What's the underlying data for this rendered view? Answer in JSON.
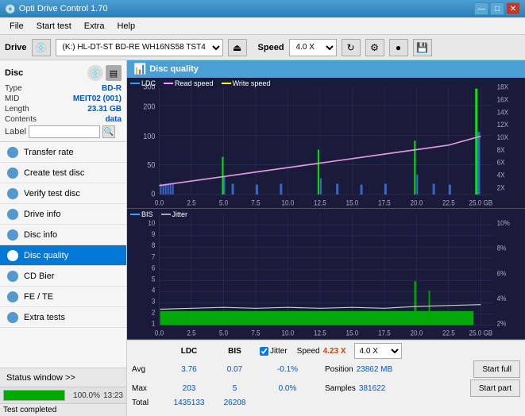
{
  "titlebar": {
    "title": "Opti Drive Control 1.70",
    "minimize": "—",
    "maximize": "□",
    "close": "✕"
  },
  "menubar": {
    "items": [
      "File",
      "Start test",
      "Extra",
      "Help"
    ]
  },
  "drivebar": {
    "label": "Drive",
    "drive_value": "(K:) HL-DT-ST BD-RE  WH16NS58 TST4",
    "speed_label": "Speed",
    "speed_value": "4.0 X"
  },
  "sidebar": {
    "disc_title": "Disc",
    "disc_type_label": "Type",
    "disc_type_val": "BD-R",
    "disc_mid_label": "MID",
    "disc_mid_val": "MEIT02 (001)",
    "disc_length_label": "Length",
    "disc_length_val": "23.31 GB",
    "disc_contents_label": "Contents",
    "disc_contents_val": "data",
    "disc_label_label": "Label",
    "disc_label_val": "",
    "nav_items": [
      {
        "id": "transfer-rate",
        "label": "Transfer rate"
      },
      {
        "id": "create-test-disc",
        "label": "Create test disc"
      },
      {
        "id": "verify-test-disc",
        "label": "Verify test disc"
      },
      {
        "id": "drive-info",
        "label": "Drive info"
      },
      {
        "id": "disc-info",
        "label": "Disc info"
      },
      {
        "id": "disc-quality",
        "label": "Disc quality",
        "active": true
      },
      {
        "id": "cd-bier",
        "label": "CD Bier"
      },
      {
        "id": "fe-te",
        "label": "FE / TE"
      },
      {
        "id": "extra-tests",
        "label": "Extra tests"
      }
    ],
    "status_window_label": "Status window >>",
    "progress_pct": "100.0%",
    "progress_time": "13:23"
  },
  "content": {
    "dq_title": "Disc quality",
    "chart1": {
      "legend_ldc": "LDC",
      "legend_read": "Read speed",
      "legend_write": "Write speed",
      "y_left_max": 300,
      "y_right_labels": [
        "18X",
        "16X",
        "14X",
        "12X",
        "10X",
        "8X",
        "6X",
        "4X",
        "2X"
      ],
      "x_labels": [
        "0.0",
        "2.5",
        "5.0",
        "7.5",
        "10.0",
        "12.5",
        "15.0",
        "17.5",
        "20.0",
        "22.5",
        "25.0 GB"
      ]
    },
    "chart2": {
      "legend_bis": "BIS",
      "legend_jitter": "Jitter",
      "y_left_labels": [
        "10",
        "9",
        "8",
        "7",
        "6",
        "5",
        "4",
        "3",
        "2",
        "1"
      ],
      "y_right_labels": [
        "10%",
        "8%",
        "6%",
        "4%",
        "2%"
      ],
      "x_labels": [
        "0.0",
        "2.5",
        "5.0",
        "7.5",
        "10.0",
        "12.5",
        "15.0",
        "17.5",
        "20.0",
        "22.5",
        "25.0 GB"
      ]
    },
    "stats": {
      "col_ldc": "LDC",
      "col_bis": "BIS",
      "jitter_label": "Jitter",
      "speed_label": "Speed",
      "speed_val": "4.23 X",
      "speed_select": "4.0 X",
      "position_label": "Position",
      "position_val": "23862 MB",
      "samples_label": "Samples",
      "samples_val": "381622",
      "avg_label": "Avg",
      "avg_ldc": "3.76",
      "avg_bis": "0.07",
      "avg_jitter": "-0.1%",
      "max_label": "Max",
      "max_ldc": "203",
      "max_bis": "5",
      "max_jitter": "0.0%",
      "total_label": "Total",
      "total_ldc": "1435133",
      "total_bis": "26208",
      "btn_start_full": "Start full",
      "btn_start_part": "Start part"
    }
  },
  "status": {
    "test_completed": "Test completed"
  }
}
